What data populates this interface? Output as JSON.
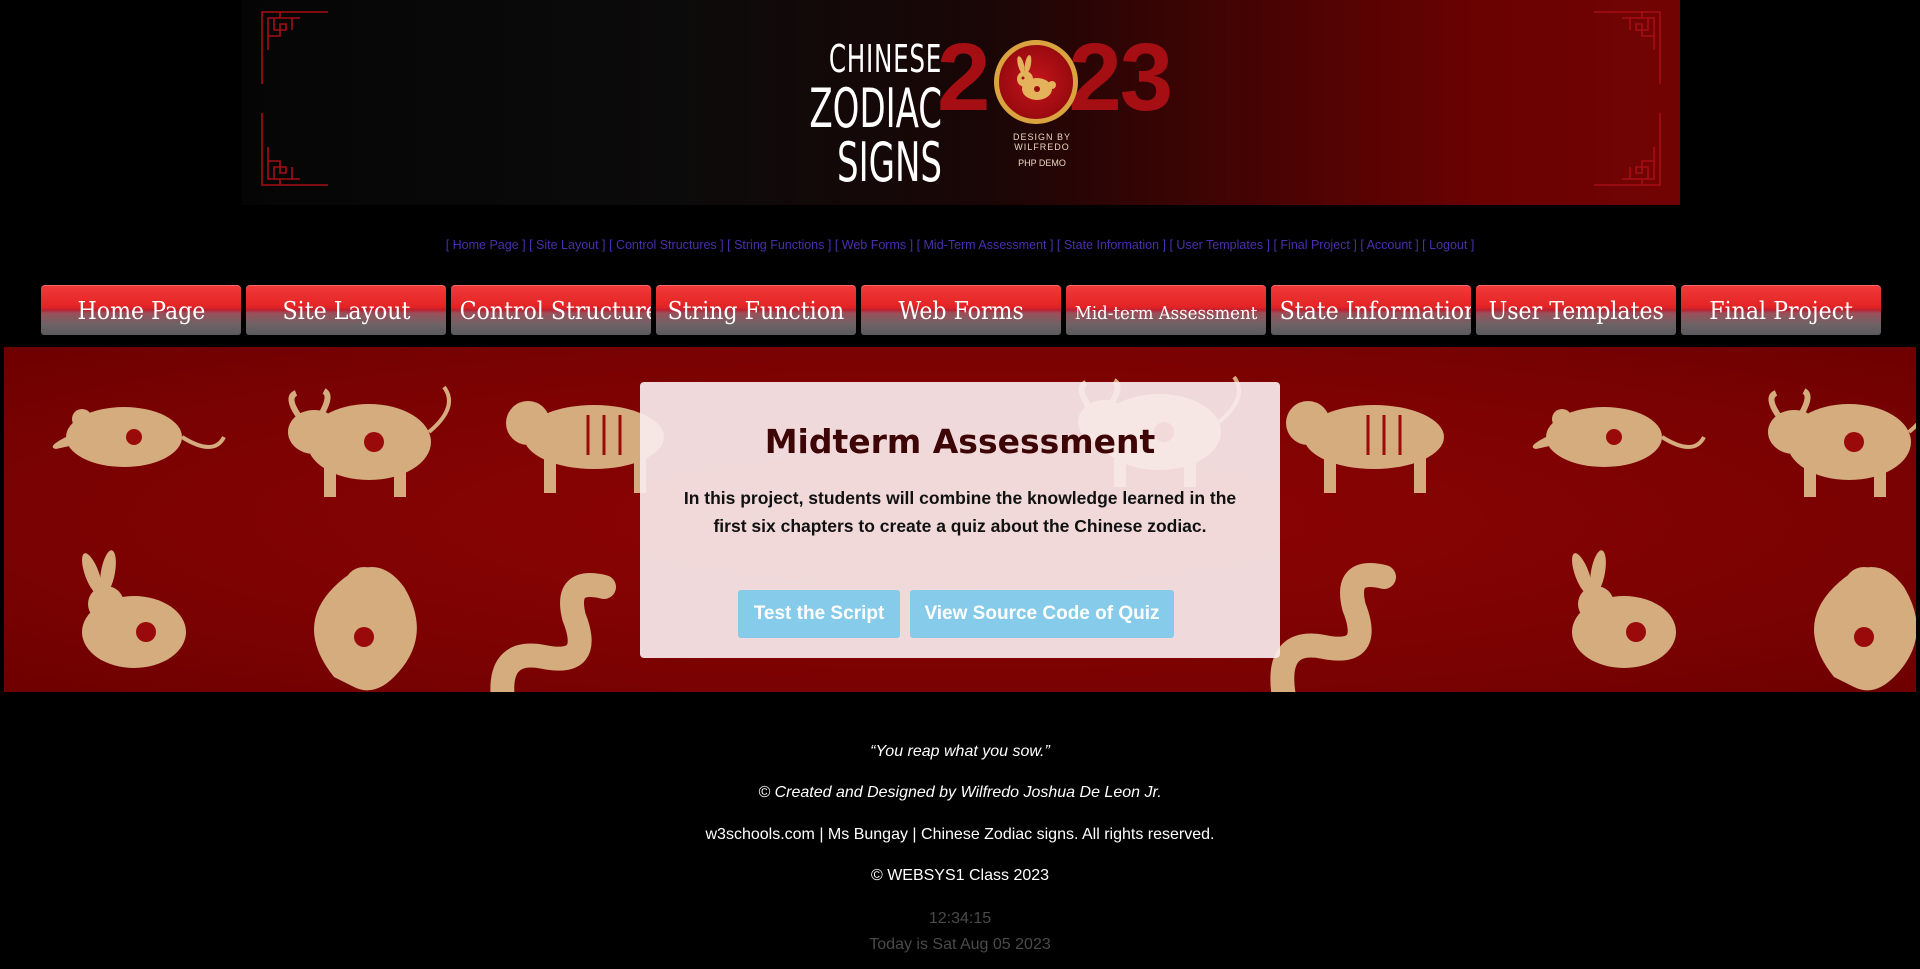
{
  "banner": {
    "logo_line1": "CHINESE",
    "logo_line2": "ZODIAC SIGNS",
    "logo_year_left": "2",
    "logo_year_right": "23",
    "logo_credit": "DESIGN BY WILFREDO",
    "logo_sub": "PHP DEMO"
  },
  "toplinks": [
    "Home Page",
    "Site Layout",
    "Control Structures",
    "String Functions",
    "Web  Forms",
    "Mid-Term Assessment",
    "State Information",
    "User Templates",
    "Final Project",
    "Account",
    "Logout"
  ],
  "nav": [
    "Home Page",
    "Site Layout",
    "Control Structure",
    "String Function",
    "Web Forms",
    "Mid-term Assessment",
    "State Information",
    "User Templates",
    "Final Project"
  ],
  "card": {
    "title": "Midterm Assessment",
    "description": "In this project, students will combine the knowledge learned in the first six chapters to create a quiz about the Chinese zodiac.",
    "btn_test": "Test the Script",
    "btn_source": "View Source Code of Quiz"
  },
  "footer": {
    "quote": "“You reap what you sow.”",
    "credit": "© Created and Designed by Wilfredo Joshua De Leon Jr.",
    "sources": "w3schools.com | Ms Bungay | Chinese Zodiac signs. All rights reserved.",
    "class": "© WEBSYS1 Class 2023",
    "time": "12:34:15",
    "date": "Today is Sat Aug 05 2023"
  },
  "colors": {
    "banner_red": "#720303",
    "year_red": "#a50f14",
    "link_purple": "#4b2fae",
    "nav_red": "#e32424",
    "hero_red": "#8c0000",
    "animal_gold": "#d4ac7e",
    "button_blue": "#86cbea"
  }
}
